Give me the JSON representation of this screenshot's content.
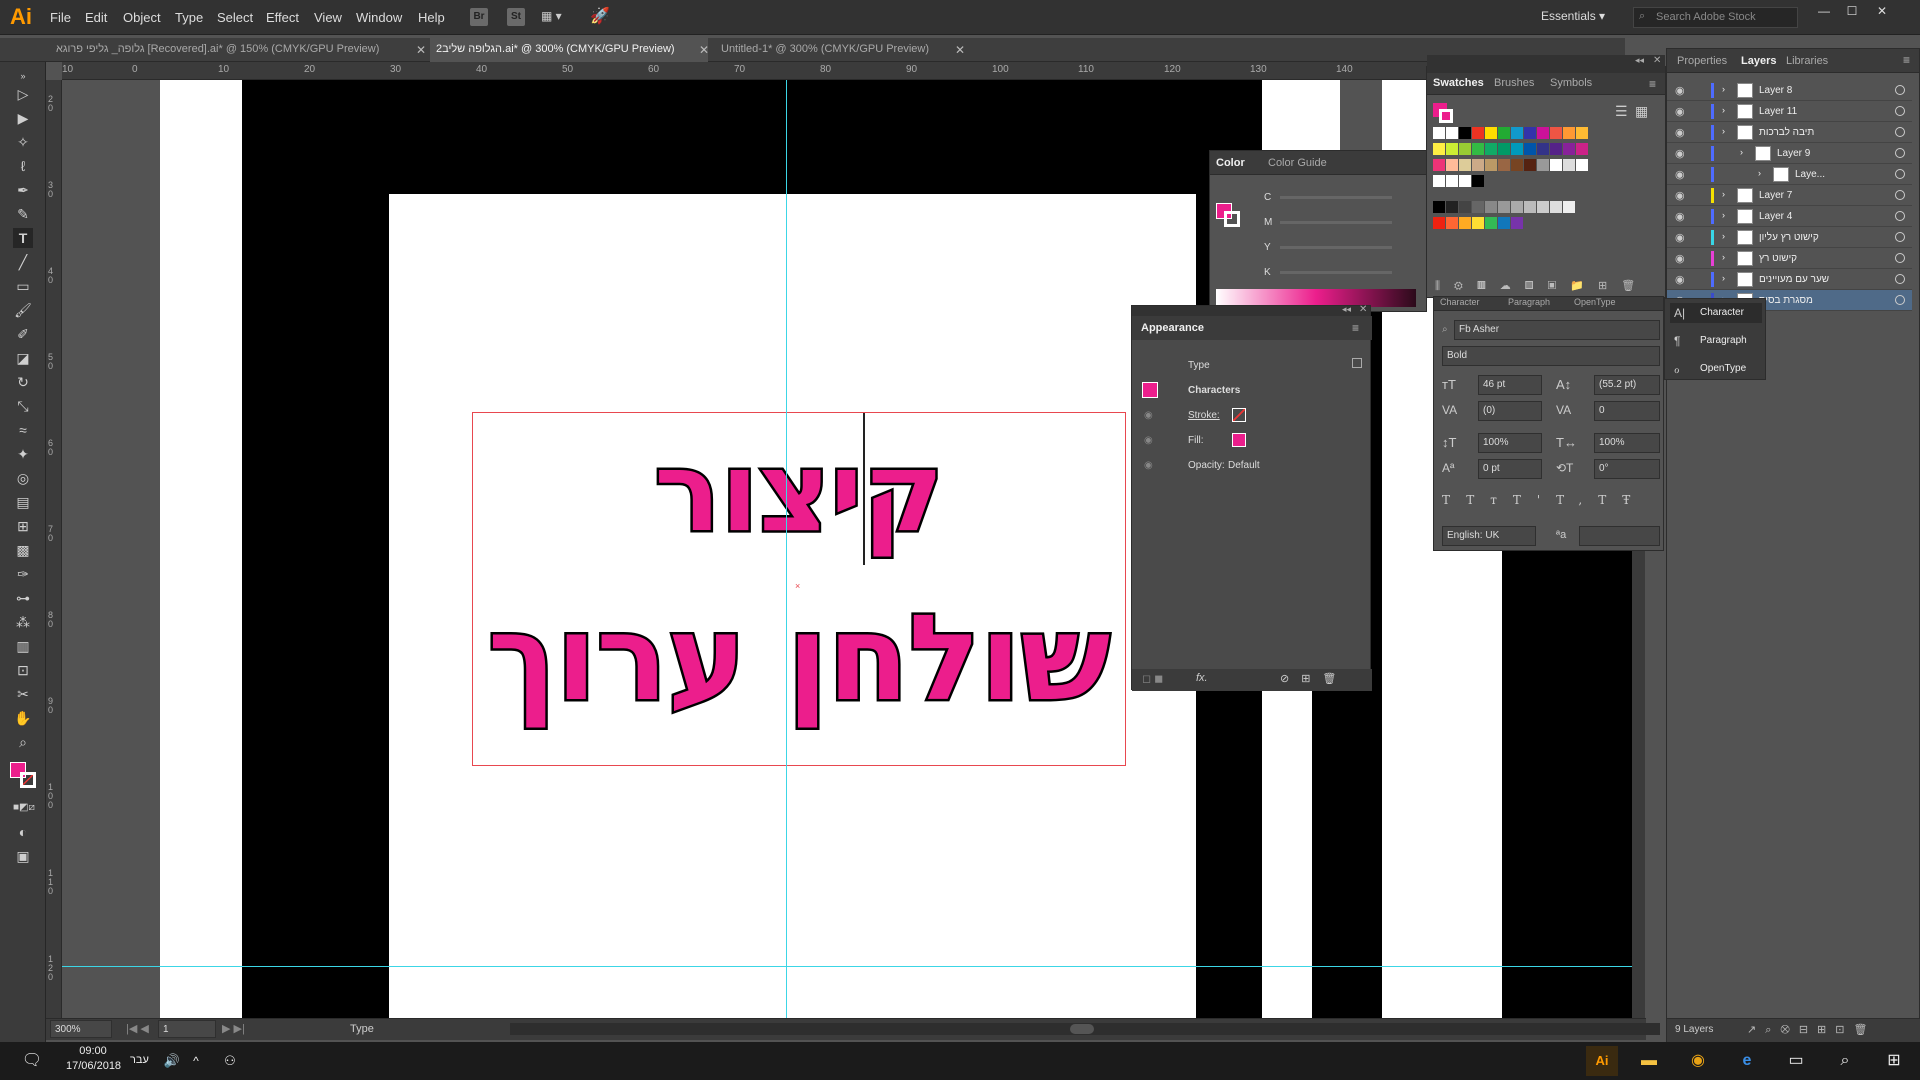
{
  "app": {
    "logo": "Ai",
    "menus": [
      "File",
      "Edit",
      "Object",
      "Type",
      "Select",
      "Effect",
      "View",
      "Window",
      "Help"
    ],
    "bridge": "Br",
    "stock": "St",
    "workspace": "Essentials",
    "search_placeholder": "Search Adobe Stock"
  },
  "tabs": [
    {
      "label": "גלופה_ גליפי פרוגא [Recovered].ai* @ 150% (CMYK/GPU Preview)",
      "active": false
    },
    {
      "label": "2הגלופה שליב.ai* @ 300% (CMYK/GPU Preview)",
      "active": true
    },
    {
      "label": "Untitled-1* @ 300% (CMYK/GPU Preview)",
      "active": false
    }
  ],
  "ruler": {
    "h": [
      "10",
      "0",
      "10",
      "20",
      "30",
      "40",
      "50",
      "60",
      "70",
      "80",
      "90",
      "100",
      "110",
      "120",
      "130",
      "140"
    ],
    "v": [
      "2 0",
      "3 0",
      "4 0",
      "5 0",
      "6 0",
      "7 0",
      "8 0",
      "9 0",
      "1 0 0",
      "1 1 0",
      "1 2 0"
    ]
  },
  "artwork": {
    "line1": "קיצור",
    "line2": "שולחן ערוך"
  },
  "colors": {
    "accent": "#ec1e8c",
    "guide": "#3cd6e6",
    "bbox": "#e8474f"
  },
  "status": {
    "zoom": "300%",
    "page": "1",
    "tool": "Type"
  },
  "layers_panel": {
    "tabs": [
      "Properties",
      "Layers",
      "Libraries"
    ],
    "layers": [
      {
        "name": "Layer 8",
        "color": "#4e6bff",
        "sel": false
      },
      {
        "name": "Layer 11",
        "color": "#4e6bff",
        "sel": false
      },
      {
        "name": "תיבה לברכות",
        "color": "#4e6bff",
        "sel": false
      },
      {
        "name": "Layer 9",
        "color": "#4e6bff",
        "sel": false
      },
      {
        "name": "Laye...",
        "color": "#4e6bff",
        "sel": false
      },
      {
        "name": "Layer 7",
        "color": "#f5e000",
        "sel": false
      },
      {
        "name": "Layer 4",
        "color": "#4e6bff",
        "sel": false
      },
      {
        "name": "קישוט רץ עליון",
        "color": "#38d6e6",
        "sel": false
      },
      {
        "name": "קישוט רץ",
        "color": "#e83fd6",
        "sel": false
      },
      {
        "name": "שער עם מעויינים",
        "color": "#4e6bff",
        "sel": false
      },
      {
        "name": "מסגרת בסיס",
        "color": "#3a4ccc",
        "sel": true
      }
    ],
    "count": "9 Layers"
  },
  "swatches_panel": {
    "tabs": [
      "Swatches",
      "Brushes",
      "Symbols"
    ]
  },
  "color_panel": {
    "tabs": [
      "Color",
      "Color Guide"
    ],
    "channels": [
      "C",
      "M",
      "Y",
      "K"
    ]
  },
  "appearance_panel": {
    "title": "Appearance",
    "type_label": "Type",
    "characters": "Characters",
    "stroke": "Stroke:",
    "fill": "Fill:",
    "opacity": "Opacity:",
    "opacity_value": "Default",
    "fx": "fx."
  },
  "character_panel": {
    "tabs": [
      "Character",
      "Paragraph",
      "OpenType"
    ],
    "font": "Fb Asher",
    "style": "Bold",
    "size": "46 pt",
    "leading": "(55.2 pt)",
    "kerning": "(0)",
    "tracking": "0",
    "vscale": "100%",
    "hscale": "100%",
    "baseline": "0 pt",
    "rotation": "0°",
    "language": "English: UK"
  },
  "flyout": {
    "items": [
      "Character",
      "Paragraph",
      "OpenType"
    ]
  },
  "taskbar": {
    "time": "09:00",
    "date": "17/06/2018",
    "lang": "עבר"
  }
}
